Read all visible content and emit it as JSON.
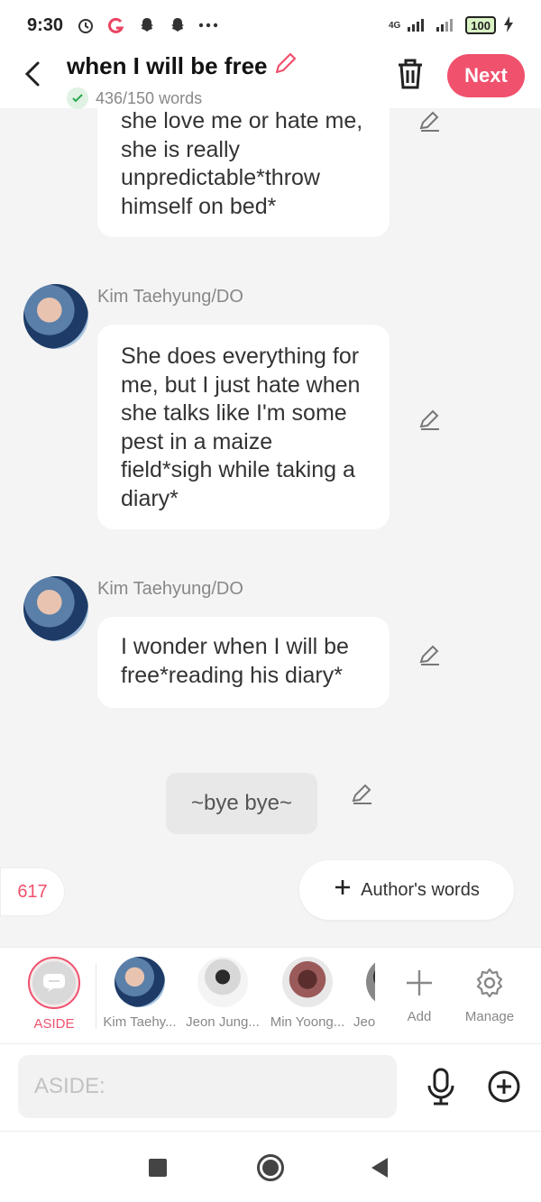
{
  "status_bar": {
    "time": "9:30",
    "network": "4G",
    "battery": "100"
  },
  "header": {
    "title": "when I will be free",
    "word_count": "436/150 words",
    "next_label": "Next"
  },
  "chat": {
    "messages": [
      {
        "speaker": "",
        "text": "she love me or hate me, she is really unpredictable*throw himself on bed*"
      },
      {
        "speaker": "Kim Taehyung/DO",
        "text": "She does everything for me, but I just hate when she talks like I'm some pest in a maize field*sigh while taking a diary*"
      },
      {
        "speaker": "Kim Taehyung/DO",
        "text": "I wonder when I will be free*reading his diary*"
      }
    ],
    "aside": "~bye bye~",
    "char_count": "617",
    "author_words_label": "Author's words"
  },
  "characters": {
    "aside_label": "ASIDE",
    "items": [
      {
        "label": "Kim Taehy..."
      },
      {
        "label": "Jeon Jung..."
      },
      {
        "label": "Min Yoong..."
      },
      {
        "label": "Jeo"
      }
    ],
    "add_label": "Add",
    "manage_label": "Manage"
  },
  "composer": {
    "placeholder": "ASIDE:"
  },
  "colors": {
    "accent": "#f0516d",
    "background": "#f4f4f4"
  }
}
